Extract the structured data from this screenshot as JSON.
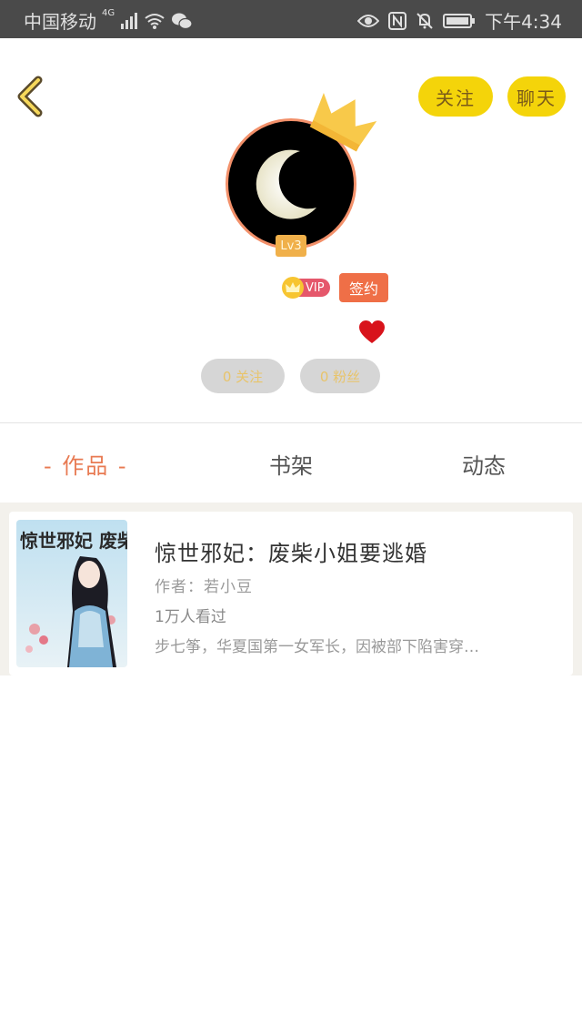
{
  "status_bar": {
    "carrier": "中国移动",
    "network": "4G",
    "time": "下午4:34"
  },
  "header": {
    "follow_label": "关注",
    "chat_label": "聊天"
  },
  "profile": {
    "level": "Lv3",
    "vip_label": "VIP",
    "signed_label": "签约",
    "following_label": "0 关注",
    "fans_label": "0 粉丝"
  },
  "tabs": [
    {
      "label": "- 作品 -",
      "active": true
    },
    {
      "label": "书架",
      "active": false
    },
    {
      "label": "动态",
      "active": false
    }
  ],
  "books": [
    {
      "title": "惊世邪妃：废柴小姐要逃婚",
      "author": "作者：若小豆",
      "views": "1万人看过",
      "description": "步七筝，华夏国第一女军长，因被部下陷害穿…",
      "cover_text": "惊世邪妃 废柴小姐"
    }
  ],
  "colors": {
    "accent_yellow": "#f4d40a",
    "tab_active": "#e87a52",
    "signed_badge": "#ef6f47",
    "vip_badge": "#e5576b"
  }
}
